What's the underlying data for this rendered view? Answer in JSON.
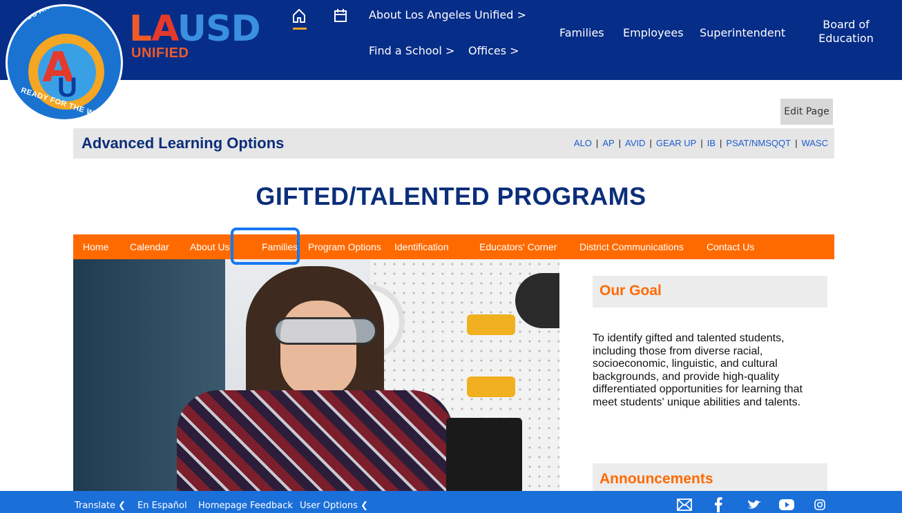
{
  "header": {
    "seal_top_text": "LOS ANGELES UNIFIED",
    "seal_bottom_text": "READY FOR THE WORLD",
    "logo_l": "L",
    "logo_a": "A",
    "logo_usd": "USD",
    "logo_sub": "UNIFIED",
    "about": "About Los Angeles Unified >",
    "find_school": "Find a School >",
    "offices": "Offices >",
    "families": "Families",
    "employees": "Employees",
    "superintendent": "Superintendent",
    "board": "Board of Education"
  },
  "edit_page": "Edit Page",
  "alo": {
    "title": "Advanced Learning Options",
    "links": [
      "ALO",
      "AP",
      "AVID",
      "GEAR UP",
      "IB",
      "PSAT/NMSQQT",
      "WASC"
    ]
  },
  "page_title": "GIFTED/TALENTED PROGRAMS",
  "nav": [
    "Home",
    "Calendar",
    "About Us",
    "Families",
    "Program Options",
    "Identification",
    "Educators' Corner",
    "District Communications",
    "Contact Us"
  ],
  "goal": {
    "title": "Our Goal",
    "text": "To identify gifted and talented students, including those from diverse racial, socioeconomic, linguistic, and cultural backgrounds, and provide high-quality differentiated opportunities for learning that meet students' unique abilities and talents."
  },
  "announcements": {
    "title": "Announcements"
  },
  "footer": {
    "translate": "Translate",
    "espanol": "En Español",
    "feedback": "Homepage Feedback",
    "user_options": "User Options"
  },
  "colors": {
    "header_bg": "#062d88",
    "nav_orange": "#ff6a00",
    "footer_blue": "#1a6fd9",
    "title_navy": "#0b2e7a",
    "highlight_blue": "#1478f2"
  }
}
